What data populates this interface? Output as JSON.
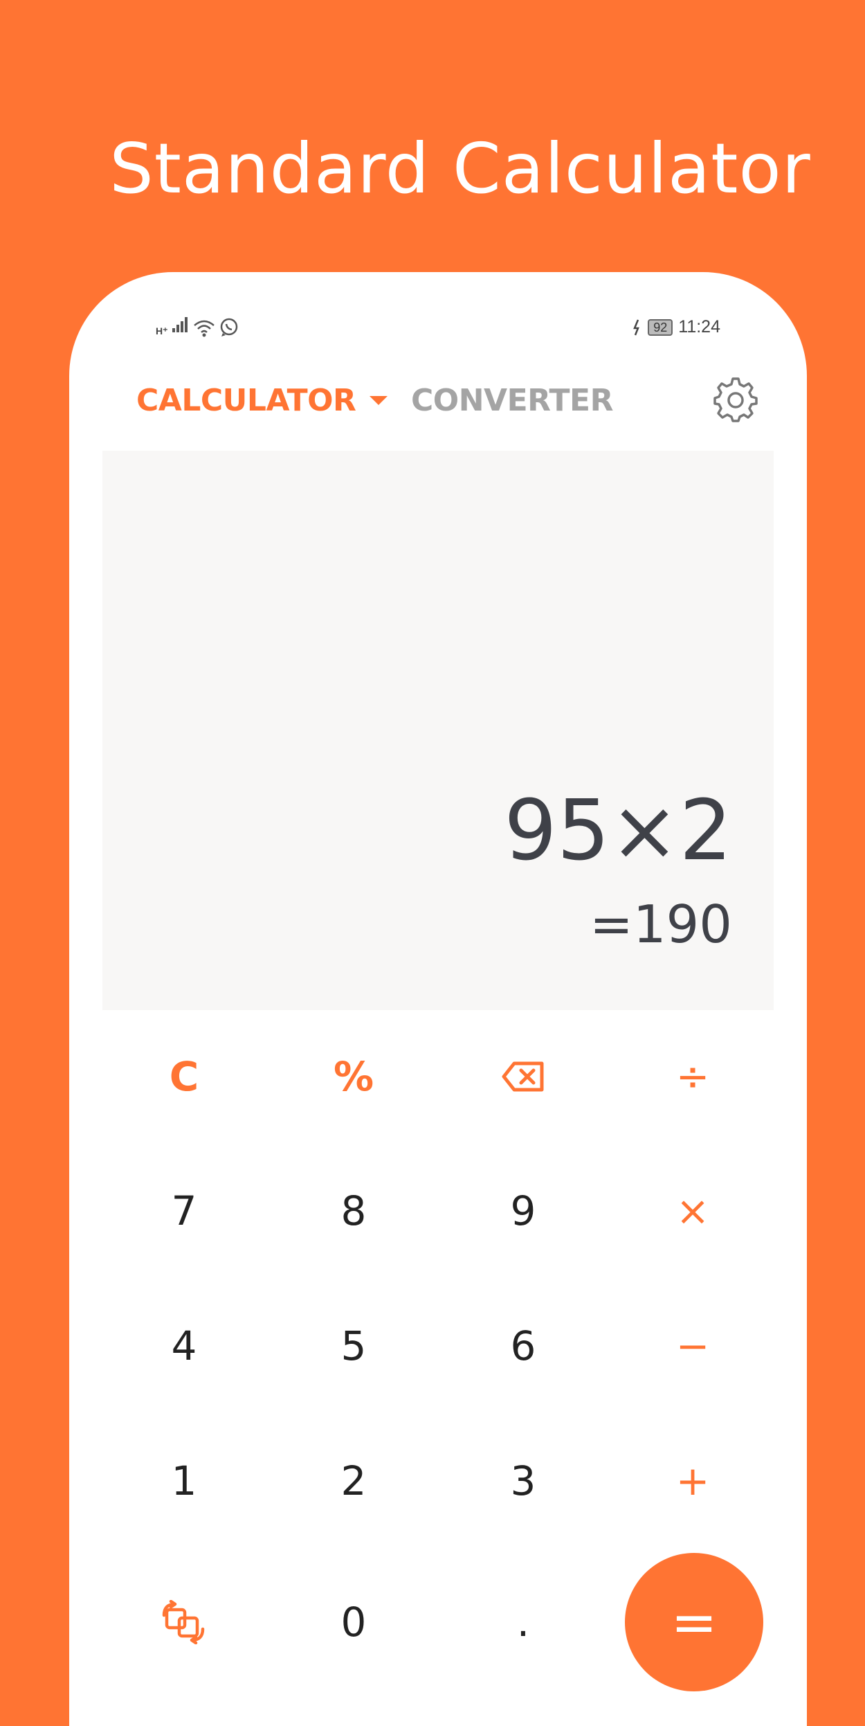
{
  "headline": "Standard Calculator",
  "status_bar": {
    "network_type": "H⁺",
    "battery": "92",
    "time": "11:24"
  },
  "tabs": {
    "calculator": "CALCULATOR",
    "converter": "CONVERTER"
  },
  "display": {
    "expression": "95×2",
    "result": "=190"
  },
  "keys": {
    "clear": "C",
    "percent": "%",
    "divide": "÷",
    "multiply": "×",
    "minus": "−",
    "plus": "+",
    "equals": "=",
    "dot": ".",
    "digits": [
      "0",
      "1",
      "2",
      "3",
      "4",
      "5",
      "6",
      "7",
      "8",
      "9"
    ]
  },
  "icons": {
    "settings": "gear-icon",
    "backspace": "backspace-icon",
    "swap": "swap-icon"
  },
  "colors": {
    "accent": "#FF7433",
    "display_bg": "#F8F7F6",
    "text_dark": "#3F4148",
    "tab_inactive": "#A4A4A4"
  }
}
